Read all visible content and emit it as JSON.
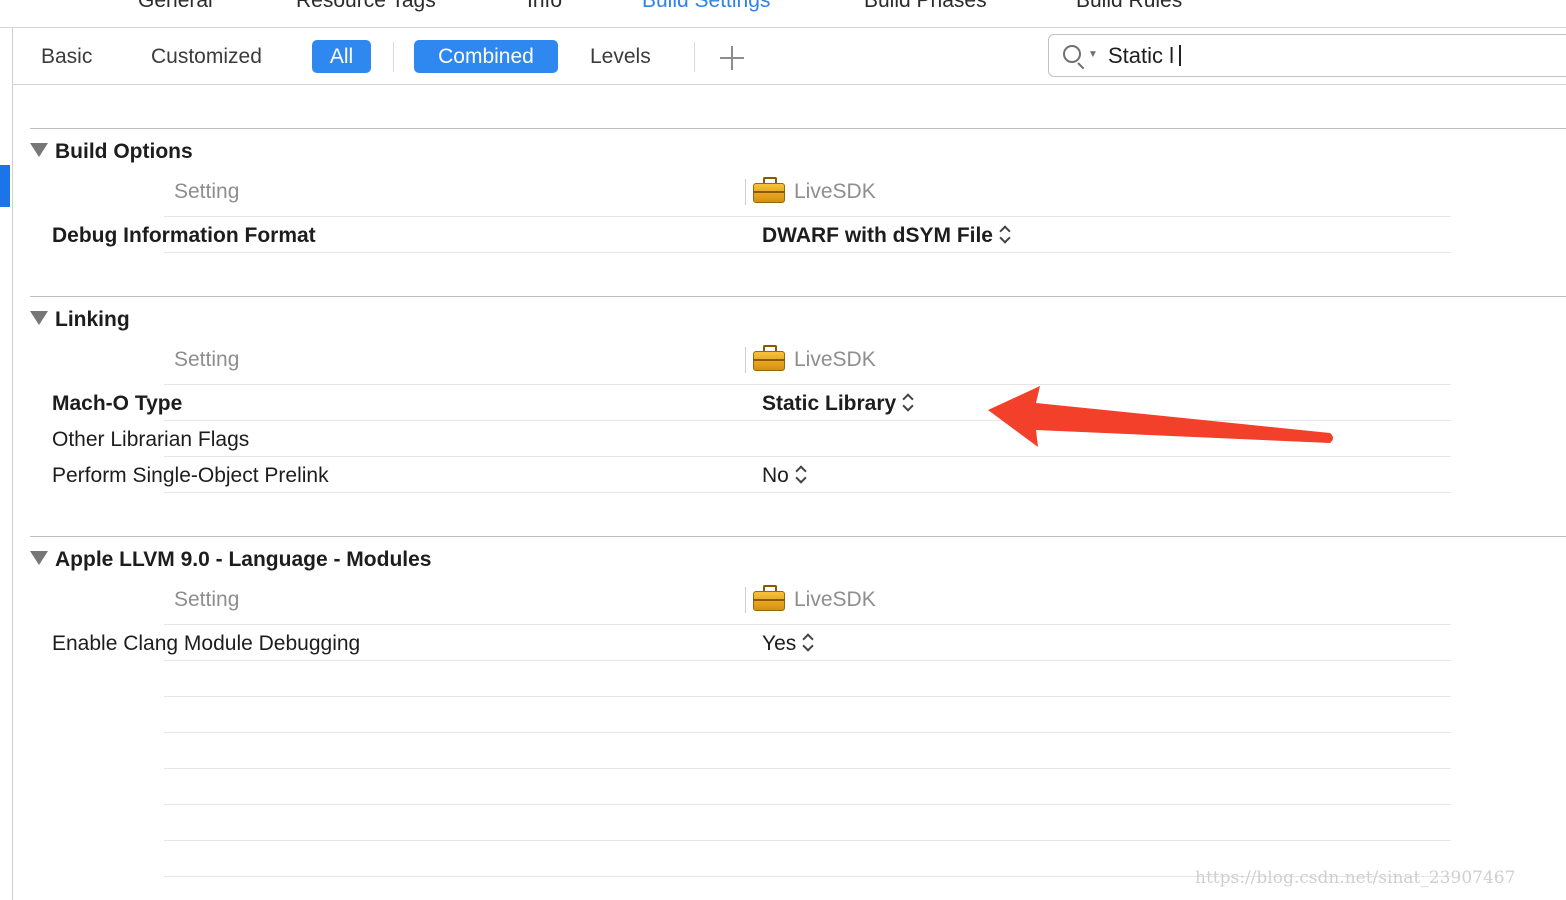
{
  "top_tabs": [
    {
      "label": "General",
      "active": false
    },
    {
      "label": "Resource Tags",
      "active": false
    },
    {
      "label": "Info",
      "active": false
    },
    {
      "label": "Build Settings",
      "active": true
    },
    {
      "label": "Build Phases",
      "active": false
    },
    {
      "label": "Build Rules",
      "active": false
    }
  ],
  "filter_bar": {
    "basic": "Basic",
    "customized": "Customized",
    "all": "All",
    "combined": "Combined",
    "levels": "Levels",
    "add_icon": "plus-icon"
  },
  "search": {
    "value": "Static l",
    "icon": "search-icon"
  },
  "column": {
    "setting_label": "Setting",
    "target_label": "LiveSDK",
    "target_icon": "briefcase-icon"
  },
  "sections": [
    {
      "title": "Build Options",
      "rows": [
        {
          "name": "Debug Information Format",
          "value": "DWARF with dSYM File",
          "bold": true
        }
      ]
    },
    {
      "title": "Linking",
      "rows": [
        {
          "name": "Mach-O Type",
          "value": "Static Library",
          "bold": true
        },
        {
          "name": "Other Librarian Flags",
          "value": "",
          "bold": false
        },
        {
          "name": "Perform Single-Object Prelink",
          "value": "No",
          "bold": false
        }
      ]
    },
    {
      "title": "Apple LLVM 9.0 - Language - Modules",
      "rows": [
        {
          "name": "Enable Clang Module Debugging",
          "value": "Yes",
          "bold": false
        }
      ]
    }
  ],
  "annotation": {
    "arrow_color": "#f2402a"
  },
  "watermark": "https://blog.csdn.net/sinat_23907467",
  "colors": {
    "accent": "#2f87f0",
    "active_tab": "#2f82e9",
    "selection_bar": "#1b74e8"
  }
}
